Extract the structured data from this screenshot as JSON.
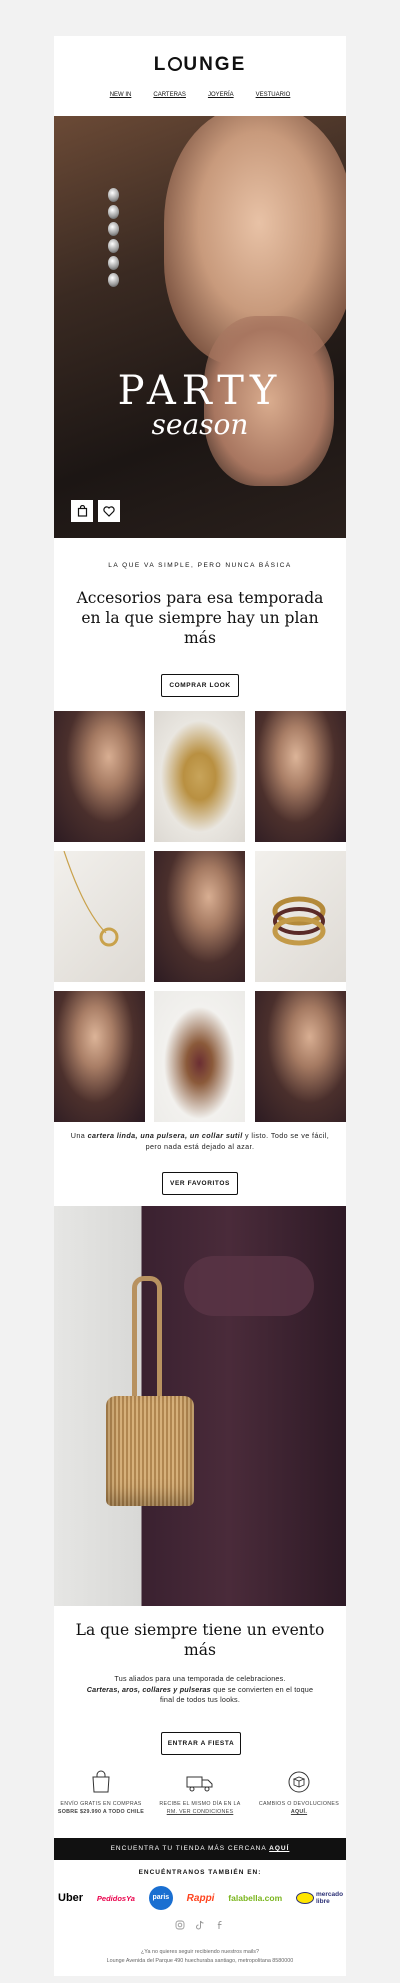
{
  "header": {
    "logo_text": "LOUNGE",
    "nav": [
      "NEW IN",
      "CARTERAS",
      "JOYERÍA",
      "VESTUARIO"
    ]
  },
  "hero": {
    "title": "PARTY",
    "subtitle": "season",
    "icons": [
      "shopping-bag-icon",
      "heart-icon"
    ]
  },
  "intro": {
    "kicker": "LA QUE VA SIMPLE, PERO NUNCA BÁSICA",
    "headline": "Accesorios para esa temporada en la que siempre hay un plan más",
    "cta": "COMPRAR LOOK"
  },
  "grid": {
    "caption_part1": "Una ",
    "caption_bold": "cartera linda, una pulsera, un collar sutil",
    "caption_part2": " y listo. Todo se ve fácil, pero nada está dejado al azar.",
    "cta": "VER FAVORITOS"
  },
  "section2": {
    "headline": "La que siempre tiene un evento más",
    "body_part1": "Tus aliados para una temporada de celebraciones.",
    "body_bold": "Carteras, aros, collares y pulseras",
    "body_part2": " que se convierten en el toque final de todos tus looks.",
    "cta": "ENTRAR A FIESTA"
  },
  "features": [
    {
      "icon": "shopping-bag-icon",
      "line1": "ENVÍO GRATIS EN COMPRAS",
      "line2": "SOBRE $29.990 A TODO CHILE"
    },
    {
      "icon": "delivery-truck-icon",
      "line1": "RECIBE EL MISMO DÍA EN LA",
      "line2": "RM. VER CONDICIONES"
    },
    {
      "icon": "returns-box-icon",
      "line1": "CAMBIOS O DEVOLUCIONES",
      "line2": "AQUÍ."
    }
  ],
  "store_bar": {
    "text": "ENCUENTRA TU TIENDA MÁS CERCANA ",
    "link": "AQUÍ"
  },
  "also_label": "ENCUÉNTRANOS TAMBIÉN EN:",
  "brands": [
    "Uber",
    "PedidosYa",
    "paris",
    "Rappi",
    "falabella.com",
    "mercado libre"
  ],
  "socials": [
    "instagram-icon",
    "tiktok-icon",
    "facebook-icon"
  ],
  "footer": {
    "line1": "¿Ya no quieres seguir recibiendo nuestros mails?",
    "line2": "Lounge Avenida del Parque 490 huechuraba santiago, metropolitana 8580000"
  },
  "colors": {
    "accent": "#111111",
    "background": "#f2f2f2",
    "white": "#ffffff",
    "ubereats": "#000000",
    "pedidosya": "#ea004b",
    "paris": "#1a6fd1",
    "rappi": "#ff441f",
    "falabella": "#7ab51d",
    "mercadolibre": "#ffe600"
  }
}
